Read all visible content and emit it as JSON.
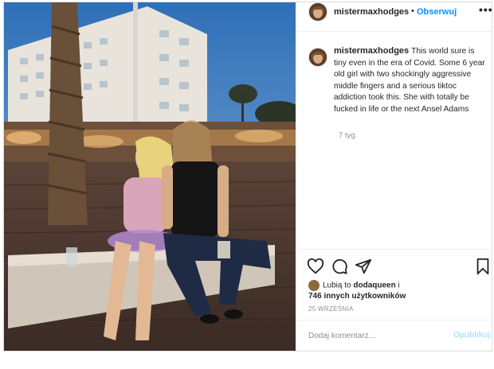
{
  "post": {
    "username": "mistermaxhodges",
    "follow_label": "Obserwuj",
    "dot_separator": "•",
    "more_label": "•••",
    "caption": "This world sure is tiny even in the era of Covid. Some 6 year old girl with two shockingly aggressive middle fingers and a serious tiktoc addiction took this. She with totally be fucked in life or the next Ansel Adams",
    "time_ago": "7 tyg.",
    "likes_prefix": "Lubią to",
    "liker": "dodaqueen",
    "likes_conj": "i",
    "likes_count": "746 innych użytkowników",
    "date": "25 WRZEŚNIA",
    "comment_placeholder": "Dodaj komentarz...",
    "publish_label": "Opublikuj"
  },
  "icons": [
    "heart-icon",
    "comment-icon",
    "share-icon",
    "bookmark-icon",
    "more-icon"
  ],
  "colors": {
    "link": "#0095f6",
    "muted": "#8e8e8e",
    "publish_disabled": "#b2dffc"
  }
}
